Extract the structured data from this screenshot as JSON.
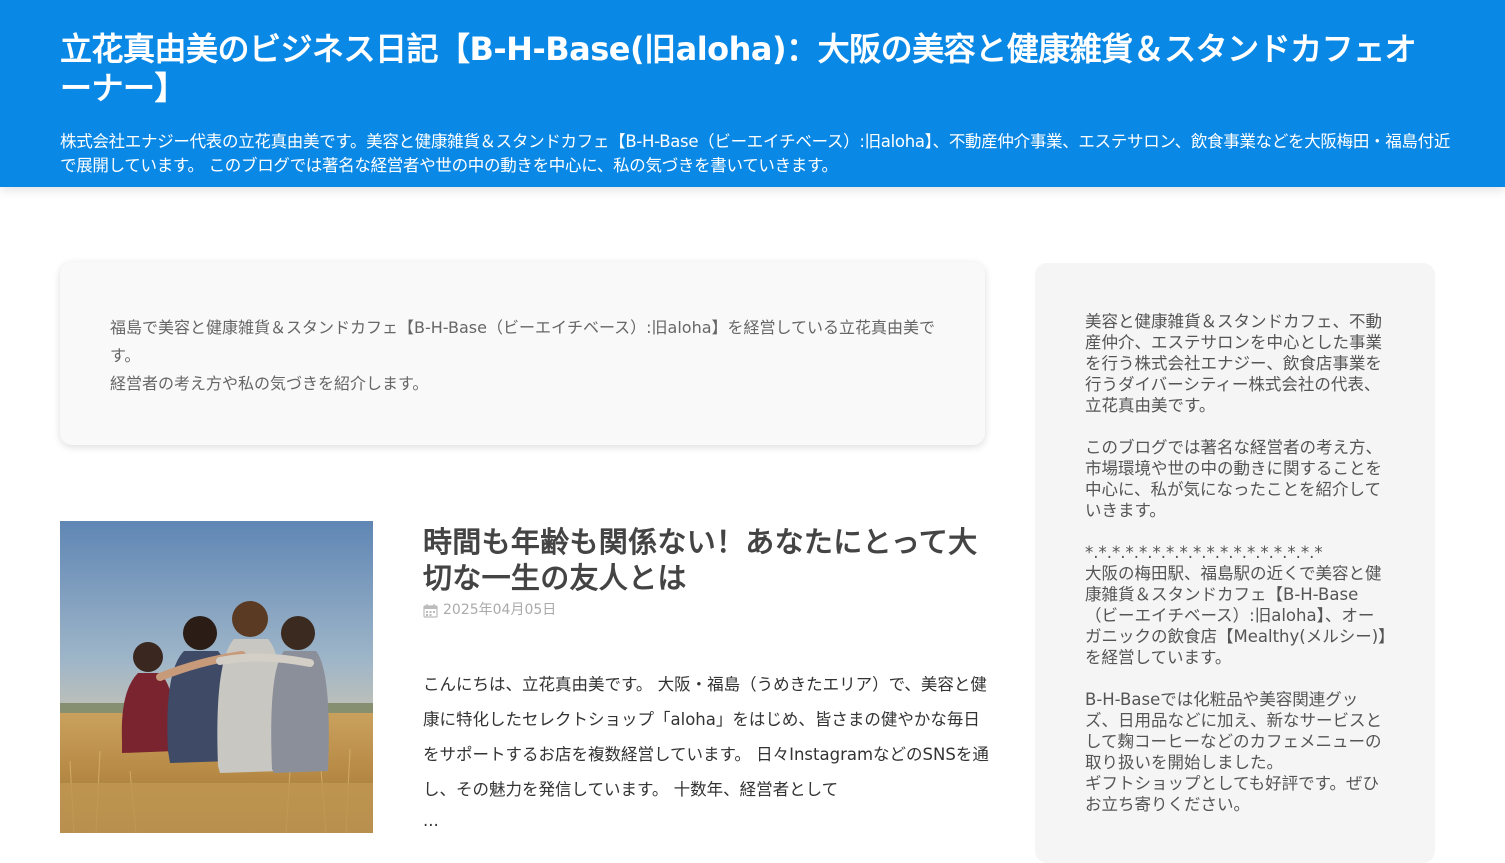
{
  "header": {
    "title": "立花真由美のビジネス日記【B-H-Base(旧aloha)：大阪の美容と健康雑貨＆スタンドカフェオーナー】",
    "description": "株式会社エナジー代表の立花真由美です。美容と健康雑貨＆スタンドカフェ【B-H-Base（ビーエイチベース）:旧aloha】、不動産仲介事業、エステサロン、飲食事業などを大阪梅田・福島付近で展開しています。 このブログでは著名な経営者や世の中の動きを中心に、私の気づきを書いていきます。"
  },
  "intro": {
    "line1": "福島で美容と健康雑貨＆スタンドカフェ【B-H-Base（ビーエイチベース）:旧aloha】を経営している立花真由美です。",
    "line2": "経営者の考え方や私の気づきを紹介します。"
  },
  "article": {
    "title": "時間も年齢も関係ない！あなたにとって大切な一生の友人とは",
    "date": "2025年04月05日",
    "excerpt": "こんにちは、立花真由美です。 大阪・福島（うめきたエリア）で、美容と健康に特化したセレクトショップ「aloha」をはじめ、皆さまの健やかな毎日をサポートするお店を複数経営しています。 日々InstagramなどのSNSを通し、その魅力を発信しています。 十数年、経営者として",
    "more": "..."
  },
  "sidebar": {
    "para1": "美容と健康雑貨＆スタンドカフェ、不動産仲介、エステサロンを中心とした事業を行う株式会社エナジー、飲食店事業を行うダイバーシティー株式会社の代表、立花真由美です。",
    "para2": "このブログでは著名な経営者の考え方、市場環境や世の中の動きに関することを中心に、私が気になったことを紹介していきます。",
    "para3_divider": "*.*.*.*.*.*.*.*.*.*.*.*.*.*.*.*.*.*",
    "para3_body": "大阪の梅田駅、福島駅の近くで美容と健康雑貨＆スタンドカフェ【B-H-Base（ビーエイチベース）:旧aloha】、オーガニックの飲食店【Mealthy(メルシー)】を経営しています。",
    "para4": "B-H-Baseでは化粧品や美容関連グッズ、日用品などに加え、新なサービスとして麹コーヒーなどのカフェメニューの取り扱いを開始しました。\nギフトショップとしても好評です。ぜひお立ち寄りください。"
  },
  "icons": {
    "date_icon": "calendar-icon"
  }
}
